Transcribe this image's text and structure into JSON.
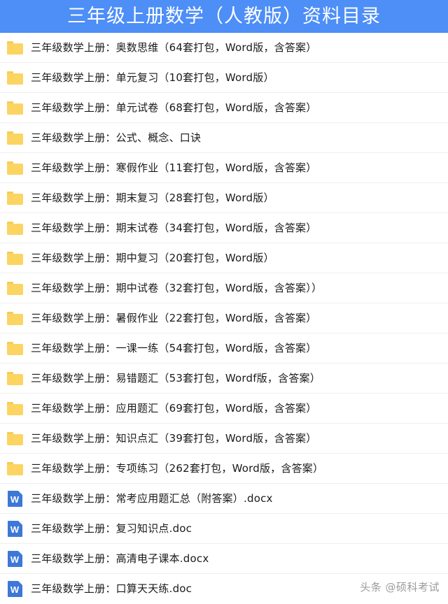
{
  "header": {
    "title": "三年级上册数学（人教版）资料目录",
    "background_color": "#4d8ef7",
    "text_color": "#ffffff"
  },
  "colors": {
    "folder_icon": "#fbd462",
    "word_icon": "#3d78d8",
    "row_divider": "#efefef",
    "text": "#1a1a1a",
    "watermark": "#9b9b9b"
  },
  "file_list": {
    "items": [
      {
        "icon": "folder-icon",
        "label": "三年级数学上册：奥数思维（64套打包，Word版，含答案）"
      },
      {
        "icon": "folder-icon",
        "label": "三年级数学上册：单元复习（10套打包，Word版）"
      },
      {
        "icon": "folder-icon",
        "label": "三年级数学上册：单元试卷（68套打包，Word版，含答案）"
      },
      {
        "icon": "folder-icon",
        "label": "三年级数学上册：公式、概念、口诀"
      },
      {
        "icon": "folder-icon",
        "label": "三年级数学上册：寒假作业（11套打包，Word版，含答案）"
      },
      {
        "icon": "folder-icon",
        "label": "三年级数学上册：期末复习（28套打包，Word版）"
      },
      {
        "icon": "folder-icon",
        "label": "三年级数学上册：期末试卷（34套打包，Word版，含答案）"
      },
      {
        "icon": "folder-icon",
        "label": "三年级数学上册：期中复习（20套打包，Word版）"
      },
      {
        "icon": "folder-icon",
        "label": "三年级数学上册：期中试卷（32套打包，Word版，含答案））"
      },
      {
        "icon": "folder-icon",
        "label": "三年级数学上册：暑假作业（22套打包，Word版，含答案）"
      },
      {
        "icon": "folder-icon",
        "label": "三年级数学上册：一课一练（54套打包，Word版，含答案）"
      },
      {
        "icon": "folder-icon",
        "label": "三年级数学上册：易错题汇（53套打包，Wordf版，含答案）"
      },
      {
        "icon": "folder-icon",
        "label": "三年级数学上册：应用题汇（69套打包，Word版，含答案）"
      },
      {
        "icon": "folder-icon",
        "label": "三年级数学上册：知识点汇（39套打包，Word版，含答案）"
      },
      {
        "icon": "folder-icon",
        "label": "三年级数学上册：专项练习（262套打包，Word版，含答案）"
      },
      {
        "icon": "word-icon",
        "icon_letter": "W",
        "label": "三年级数学上册：常考应用题汇总（附答案）.docx"
      },
      {
        "icon": "word-icon",
        "icon_letter": "W",
        "label": "三年级数学上册：复习知识点.doc"
      },
      {
        "icon": "word-icon",
        "icon_letter": "W",
        "label": "三年级数学上册：高清电子课本.docx"
      },
      {
        "icon": "word-icon",
        "icon_letter": "W",
        "label": "三年级数学上册：口算天天练.doc"
      }
    ]
  },
  "watermark": {
    "text": "头条 @硕科考试"
  }
}
